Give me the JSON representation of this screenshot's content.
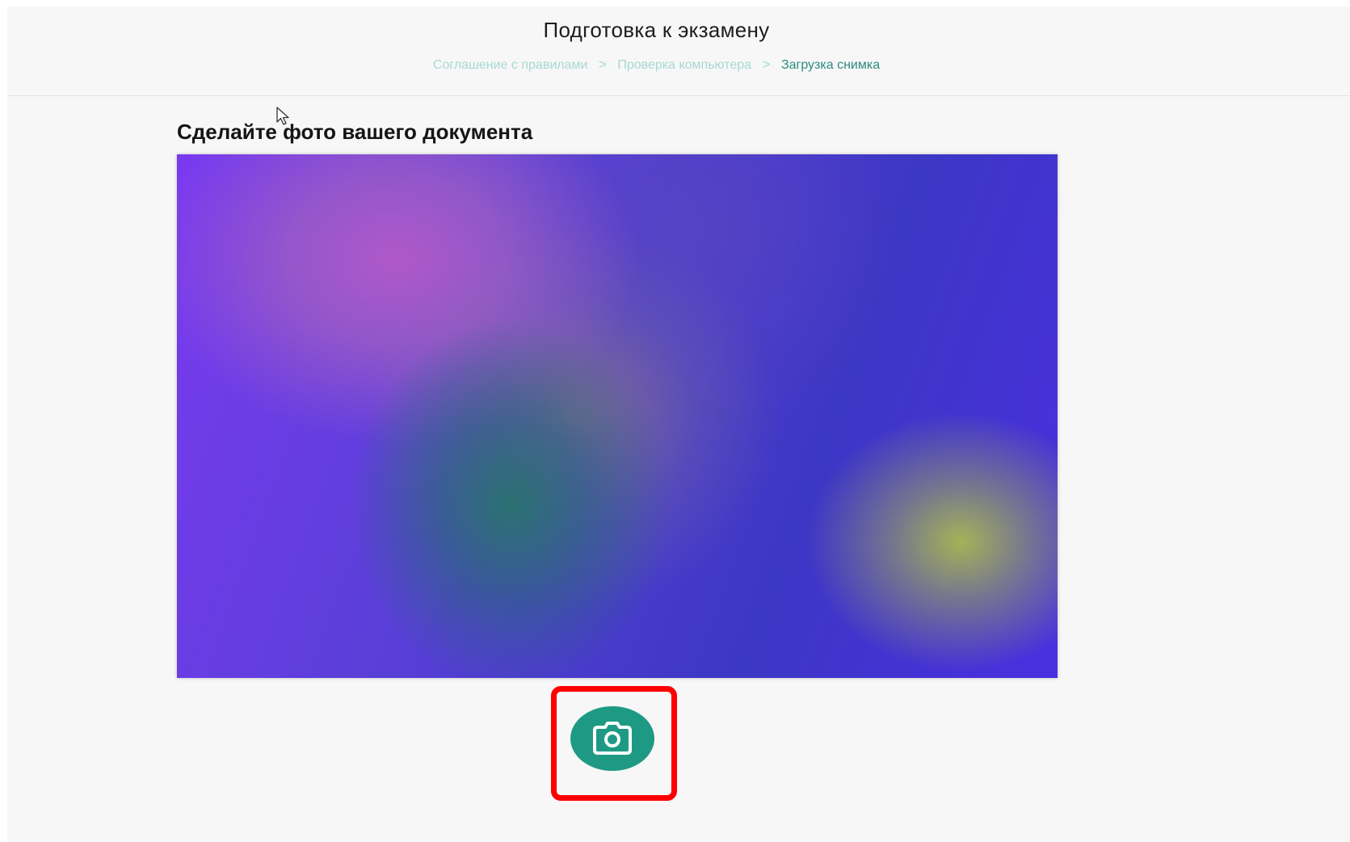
{
  "header": {
    "title": "Подготовка к экзамену",
    "breadcrumb": [
      {
        "label": "Соглашение с правилами"
      },
      {
        "label": "Проверка компьютера"
      },
      {
        "label": "Загрузка снимка"
      }
    ],
    "separator": ">"
  },
  "main": {
    "section_title": "Сделайте фото вашего документа",
    "capture_button_icon": "camera-icon"
  },
  "colors": {
    "accent": "#1e9a84",
    "breadcrumb_inactive": "#a8d8d2",
    "breadcrumb_active": "#2e8b7f",
    "highlight": "#ff0000"
  }
}
